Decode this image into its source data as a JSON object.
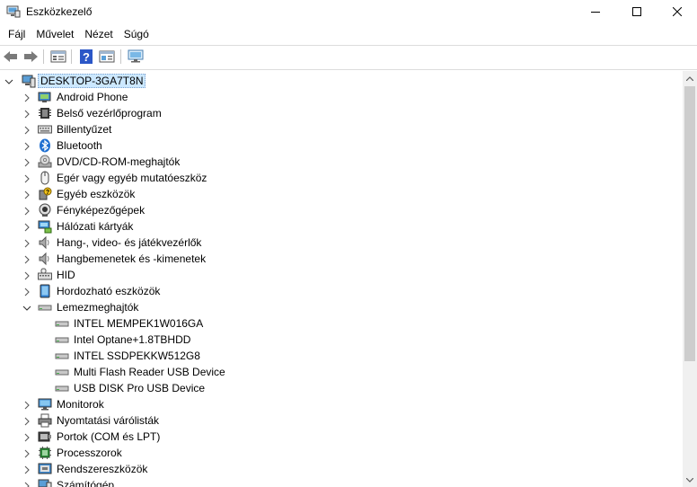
{
  "window": {
    "title": "Eszközkezelő",
    "icon": "device-manager-icon"
  },
  "menu": [
    {
      "label": "Fájl"
    },
    {
      "label": "Művelet"
    },
    {
      "label": "Nézet"
    },
    {
      "label": "Súgó"
    }
  ],
  "toolbar": {
    "buttons": [
      {
        "icon": "back-arrow-icon"
      },
      {
        "icon": "forward-arrow-icon"
      },
      {
        "icon": "properties-icon"
      },
      {
        "icon": "help-icon"
      },
      {
        "icon": "view-icon"
      },
      {
        "icon": "monitor-scan-icon"
      }
    ]
  },
  "tree": {
    "root": {
      "label": "DESKTOP-3GA7T8N",
      "icon": "computer-icon",
      "expanded": true
    },
    "items": [
      {
        "label": "Android Phone",
        "icon": "phone-icon",
        "expanded": false
      },
      {
        "label": "Belső vezérlőprogram",
        "icon": "firmware-chip-icon",
        "expanded": false
      },
      {
        "label": "Billentyűzet",
        "icon": "keyboard-icon",
        "expanded": false
      },
      {
        "label": "Bluetooth",
        "icon": "bluetooth-icon",
        "expanded": false
      },
      {
        "label": "DVD/CD-ROM-meghajtók",
        "icon": "dvd-drive-icon",
        "expanded": false
      },
      {
        "label": "Egér vagy egyéb mutatóeszköz",
        "icon": "mouse-icon",
        "expanded": false
      },
      {
        "label": "Egyéb eszközök",
        "icon": "other-devices-icon",
        "expanded": false
      },
      {
        "label": "Fényképezőgépek",
        "icon": "camera-icon",
        "expanded": false
      },
      {
        "label": "Hálózati kártyák",
        "icon": "network-adapter-icon",
        "expanded": false
      },
      {
        "label": "Hang-, video- és játékvezérlők",
        "icon": "speaker-icon",
        "expanded": false
      },
      {
        "label": "Hangbemenetek és -kimenetek",
        "icon": "audio-io-icon",
        "expanded": false
      },
      {
        "label": "HID",
        "icon": "hid-icon",
        "expanded": false
      },
      {
        "label": "Hordozható eszközök",
        "icon": "portable-device-icon",
        "expanded": false
      },
      {
        "label": "Lemezmeghajtók",
        "icon": "disk-drive-icon",
        "expanded": true,
        "children": [
          {
            "label": "INTEL MEMPEK1W016GA",
            "icon": "disk-icon"
          },
          {
            "label": "Intel Optane+1.8TBHDD",
            "icon": "disk-icon"
          },
          {
            "label": "INTEL SSDPEKKW512G8",
            "icon": "disk-icon"
          },
          {
            "label": "Multi Flash Reader USB Device",
            "icon": "disk-icon"
          },
          {
            "label": "USB DISK Pro USB Device",
            "icon": "disk-icon"
          }
        ]
      },
      {
        "label": "Monitorok",
        "icon": "monitor-icon",
        "expanded": false
      },
      {
        "label": "Nyomtatási várólisták",
        "icon": "printer-icon",
        "expanded": false
      },
      {
        "label": "Portok (COM és LPT)",
        "icon": "port-icon",
        "expanded": false
      },
      {
        "label": "Processzorok",
        "icon": "processor-icon",
        "expanded": false
      },
      {
        "label": "Rendszereszközök",
        "icon": "system-devices-icon",
        "expanded": false
      },
      {
        "label": "Számítógép",
        "icon": "computer-icon",
        "expanded": false
      }
    ]
  },
  "colors": {
    "selection_bg": "#cce8ff",
    "scrollbar_thumb": "#cdcdcd"
  }
}
